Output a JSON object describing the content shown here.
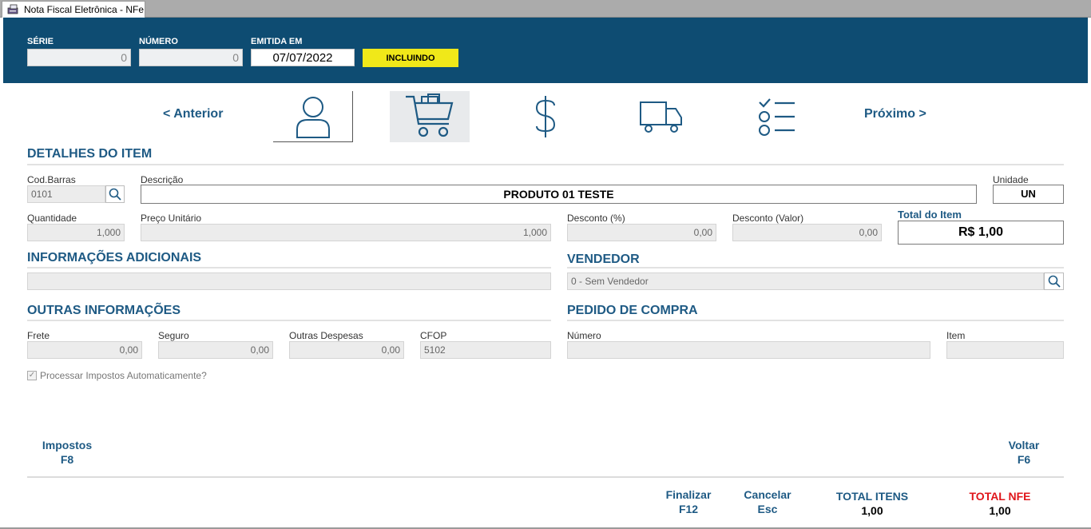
{
  "window": {
    "tab_title": "Nota Fiscal Eletrônica - NFe"
  },
  "header": {
    "serie_label": "SÉRIE",
    "serie_value": "0",
    "numero_label": "NÚMERO",
    "numero_value": "0",
    "emitida_label": "EMITIDA EM",
    "emitida_value": "07/07/2022",
    "status": "INCLUINDO"
  },
  "nav": {
    "prev": "< Anterior",
    "next": "Próximo >",
    "icons": [
      "person-icon",
      "shopping-cart-icon",
      "dollar-icon",
      "truck-icon",
      "checklist-icon"
    ]
  },
  "item": {
    "section_title": "DETALHES DO ITEM",
    "codbarras_label": "Cod.Barras",
    "codbarras_value": "0101",
    "descricao_label": "Descrição",
    "descricao_value": "PRODUTO 01 TESTE",
    "unidade_label": "Unidade",
    "unidade_value": "UN",
    "quantidade_label": "Quantidade",
    "quantidade_value": "1,000",
    "preco_label": "Preço Unitário",
    "preco_value": "1,000",
    "desc_pct_label": "Desconto (%)",
    "desc_pct_value": "0,00",
    "desc_val_label": "Desconto (Valor)",
    "desc_val_value": "0,00",
    "total_label": "Total do Item",
    "total_value": "R$ 1,00"
  },
  "info_adicionais": {
    "title": "INFORMAÇÕES ADICIONAIS",
    "value": ""
  },
  "vendedor": {
    "title": "VENDEDOR",
    "value": "0 - Sem Vendedor"
  },
  "outras": {
    "title": "OUTRAS INFORMAÇÕES",
    "frete_label": "Frete",
    "frete_value": "0,00",
    "seguro_label": "Seguro",
    "seguro_value": "0,00",
    "despesas_label": "Outras Despesas",
    "despesas_value": "0,00",
    "cfop_label": "CFOP",
    "cfop_value": "5102",
    "checkbox_label": "Processar Impostos Automaticamente?",
    "checkbox_checked": true
  },
  "pedido": {
    "title": "PEDIDO DE COMPRA",
    "numero_label": "Número",
    "numero_value": "",
    "item_label": "Item",
    "item_value": ""
  },
  "footer": {
    "impostos": "Impostos",
    "impostos_key": "F8",
    "voltar": "Voltar",
    "voltar_key": "F6",
    "finalizar": "Finalizar",
    "finalizar_key": "F12",
    "cancelar": "Cancelar",
    "cancelar_key": "Esc",
    "total_itens_label": "TOTAL ITENS",
    "total_itens_value": "1,00",
    "total_nfe_label": "TOTAL NFE",
    "total_nfe_value": "1,00"
  },
  "colors": {
    "header_bg": "#0e4c72",
    "accent": "#1e5a84",
    "status_bg": "#f0e819",
    "total_nfe": "#e0161b"
  }
}
